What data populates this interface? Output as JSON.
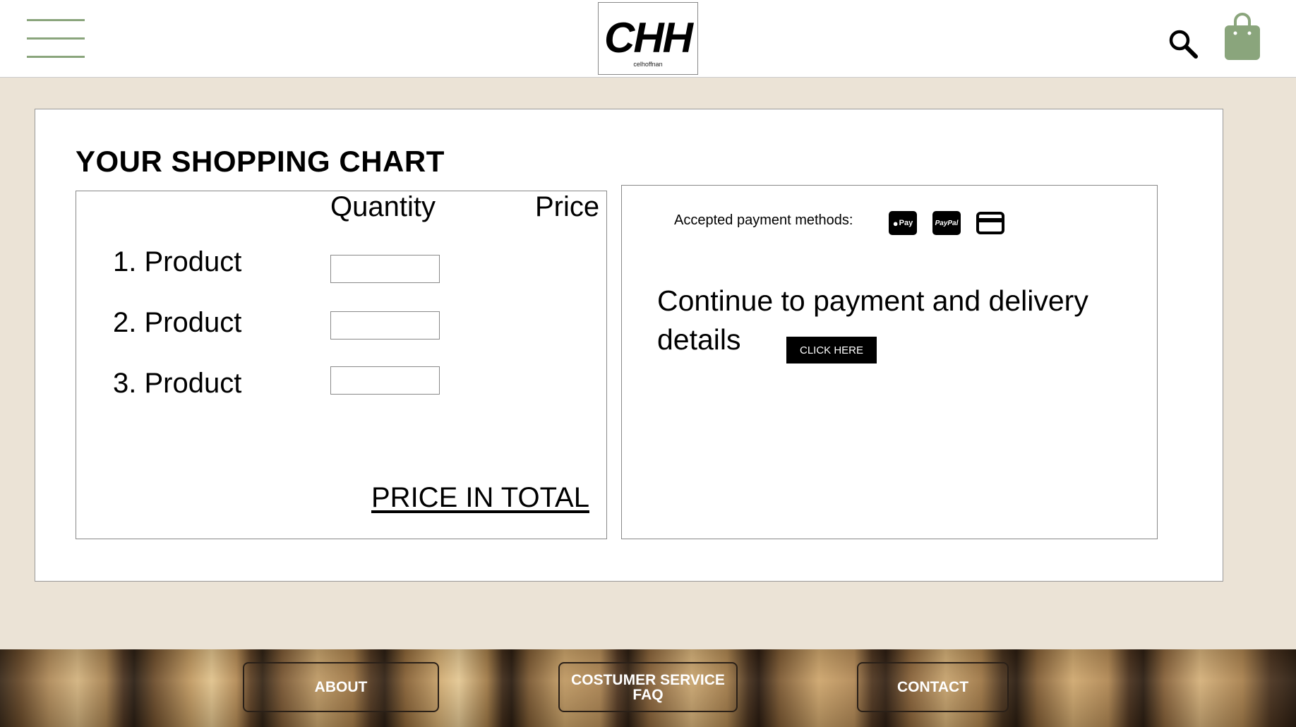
{
  "header": {
    "logo_text": "CHH",
    "logo_subtext": "celhoffnan",
    "menu_icon": "hamburger-menu-icon",
    "search_icon": "search-icon",
    "bag_icon": "shopping-bag-icon",
    "accent_color": "#8aa57c"
  },
  "cart": {
    "title": "YOUR SHOPPING CHART",
    "quantity_header": "Quantity",
    "price_header": "Price",
    "items": [
      {
        "label": "1. Product",
        "quantity": ""
      },
      {
        "label": "2. Product",
        "quantity": ""
      },
      {
        "label": "3. Product",
        "quantity": ""
      }
    ],
    "total_label": "PRICE IN TOTAL"
  },
  "payment": {
    "accepted_label": "Accepted payment methods:",
    "methods": [
      {
        "name": "apple-pay-icon",
        "text": "Pay"
      },
      {
        "name": "paypal-icon",
        "text": "PayPal"
      },
      {
        "name": "credit-card-icon",
        "text": ""
      }
    ],
    "continue_text": "Continue to payment and delivery details",
    "button_label": "CLICK HERE"
  },
  "footer": {
    "about_label": "ABOUT",
    "service_line1": "COSTUMER SERVICE",
    "service_line2": "FAQ",
    "contact_label": "CONTACT"
  },
  "colors": {
    "page_background": "#ebe3d6",
    "panel_background": "#ffffff",
    "button_background": "#000000"
  }
}
